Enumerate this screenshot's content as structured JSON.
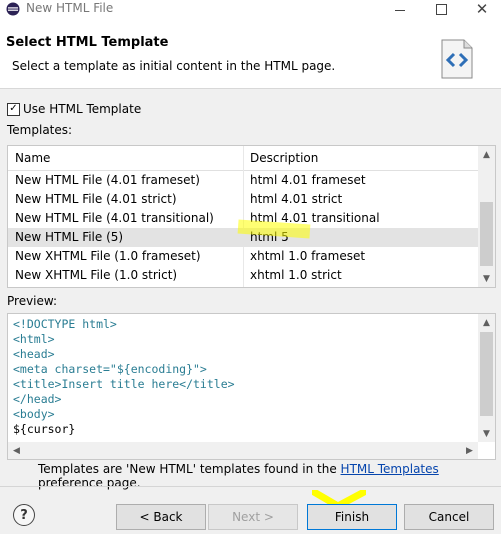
{
  "window": {
    "title": "New HTML File"
  },
  "header": {
    "title": "Select HTML Template",
    "description": "Select a template as initial content in the HTML page."
  },
  "use_template": {
    "label": "Use HTML Template",
    "checked": true
  },
  "templates_label": "Templates:",
  "table": {
    "columns": [
      "Name",
      "Description"
    ],
    "rows": [
      {
        "name": "New HTML File (4.01 frameset)",
        "description": "html 4.01 frameset"
      },
      {
        "name": "New HTML File (4.01 strict)",
        "description": "html 4.01 strict"
      },
      {
        "name": "New HTML File (4.01 transitional)",
        "description": "html 4.01 transitional"
      },
      {
        "name": "New HTML File (5)",
        "description": "html 5",
        "selected": true
      },
      {
        "name": "New XHTML File (1.0 frameset)",
        "description": "xhtml 1.0 frameset"
      },
      {
        "name": "New XHTML File (1.0 strict)",
        "description": "xhtml 1.0 strict"
      }
    ]
  },
  "preview_label": "Preview:",
  "preview": {
    "lines": [
      "<!DOCTYPE html>",
      "<html>",
      "<head>",
      "<meta charset=\"${encoding}\">",
      "<title>Insert title here</title>",
      "</head>",
      "<body>",
      "${cursor}"
    ]
  },
  "footer_note": {
    "prefix": "Templates are 'New HTML' templates found in the ",
    "link": "HTML Templates",
    "suffix": " preference page."
  },
  "buttons": {
    "help": "?",
    "back": "< Back",
    "next": "Next >",
    "finish": "Finish",
    "cancel": "Cancel"
  },
  "colors": {
    "accent": "#0078d7",
    "highlight": "#ffff00"
  }
}
